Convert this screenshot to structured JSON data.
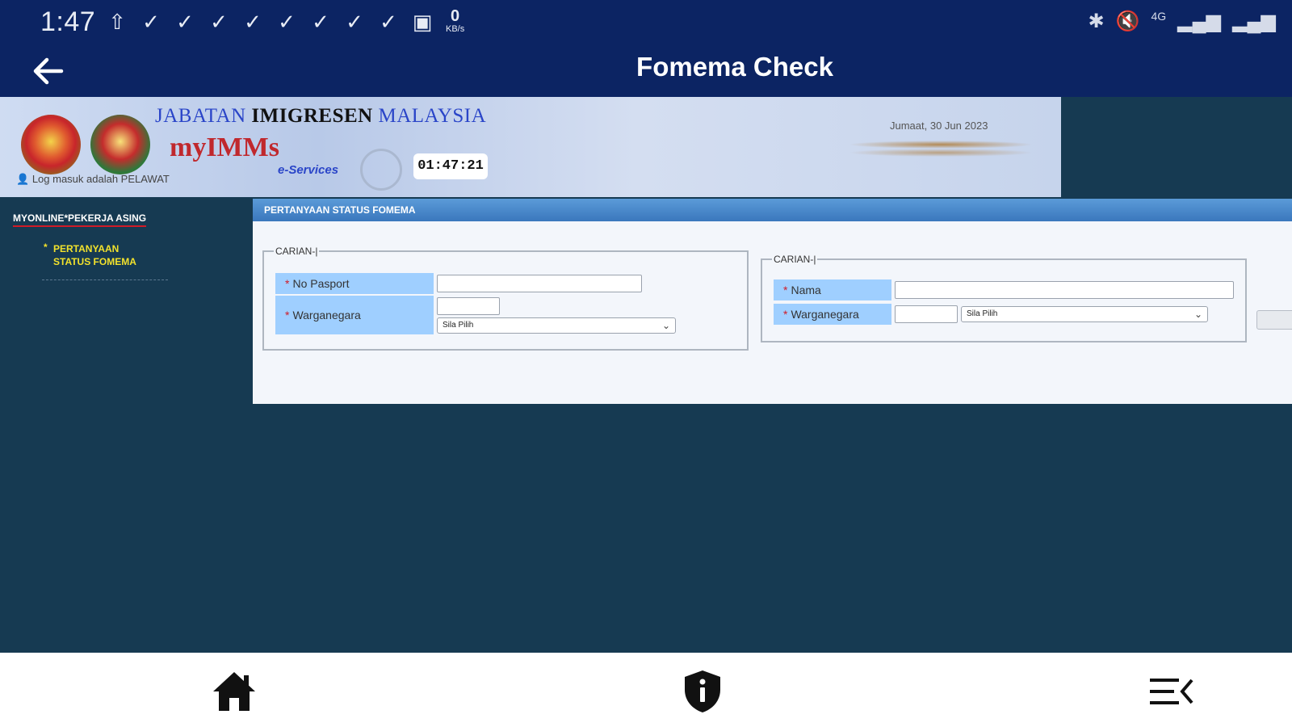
{
  "status_bar": {
    "time": "1:47",
    "notification_icons": [
      "upload-icon",
      "check-icon",
      "check-icon",
      "check-icon",
      "check-icon",
      "check-icon",
      "check-icon",
      "check-icon",
      "check-icon",
      "image-icon"
    ],
    "data_rate_value": "0",
    "data_rate_unit": "KB/s",
    "network_label": "4G"
  },
  "app_bar": {
    "title": "Fomema Check"
  },
  "banner": {
    "dept_part1": "JABATAN",
    "dept_part2": "IMIGRESEN",
    "dept_part3": "MALAYSIA",
    "brand": "myIMMs",
    "subbrand": "e-Services",
    "clock": "01:47:21",
    "login_status": "Log masuk adalah PELAWAT",
    "date": "Jumaat, 30 Jun 2023"
  },
  "sidebar": {
    "title": "MYONLINE*PEKERJA ASING",
    "item_bullet": "*",
    "item_line1": "PERTANYAAN",
    "item_line2": "STATUS FOMEMA"
  },
  "panel": {
    "header": "PERTANYAAN STATUS FOMEMA",
    "required_mark": "*",
    "search_left": {
      "legend": "CARIAN-|",
      "passport_label": "No Pasport",
      "passport_value": "",
      "nationality_label": "Warganegara",
      "nationality_code": "",
      "nationality_select": "Sila Pilih"
    },
    "search_right": {
      "legend": "CARIAN-|",
      "name_label": "Nama",
      "name_value": "",
      "nationality_label": "Warganegara",
      "nationality_code": "",
      "nationality_select": "Sila Pilih"
    }
  },
  "colors": {
    "app_bar": "#0c2463",
    "page_bg": "#163a52",
    "label_bg": "#9fcfff",
    "accent_yellow": "#f2e22c",
    "accent_red": "#d01b27"
  }
}
